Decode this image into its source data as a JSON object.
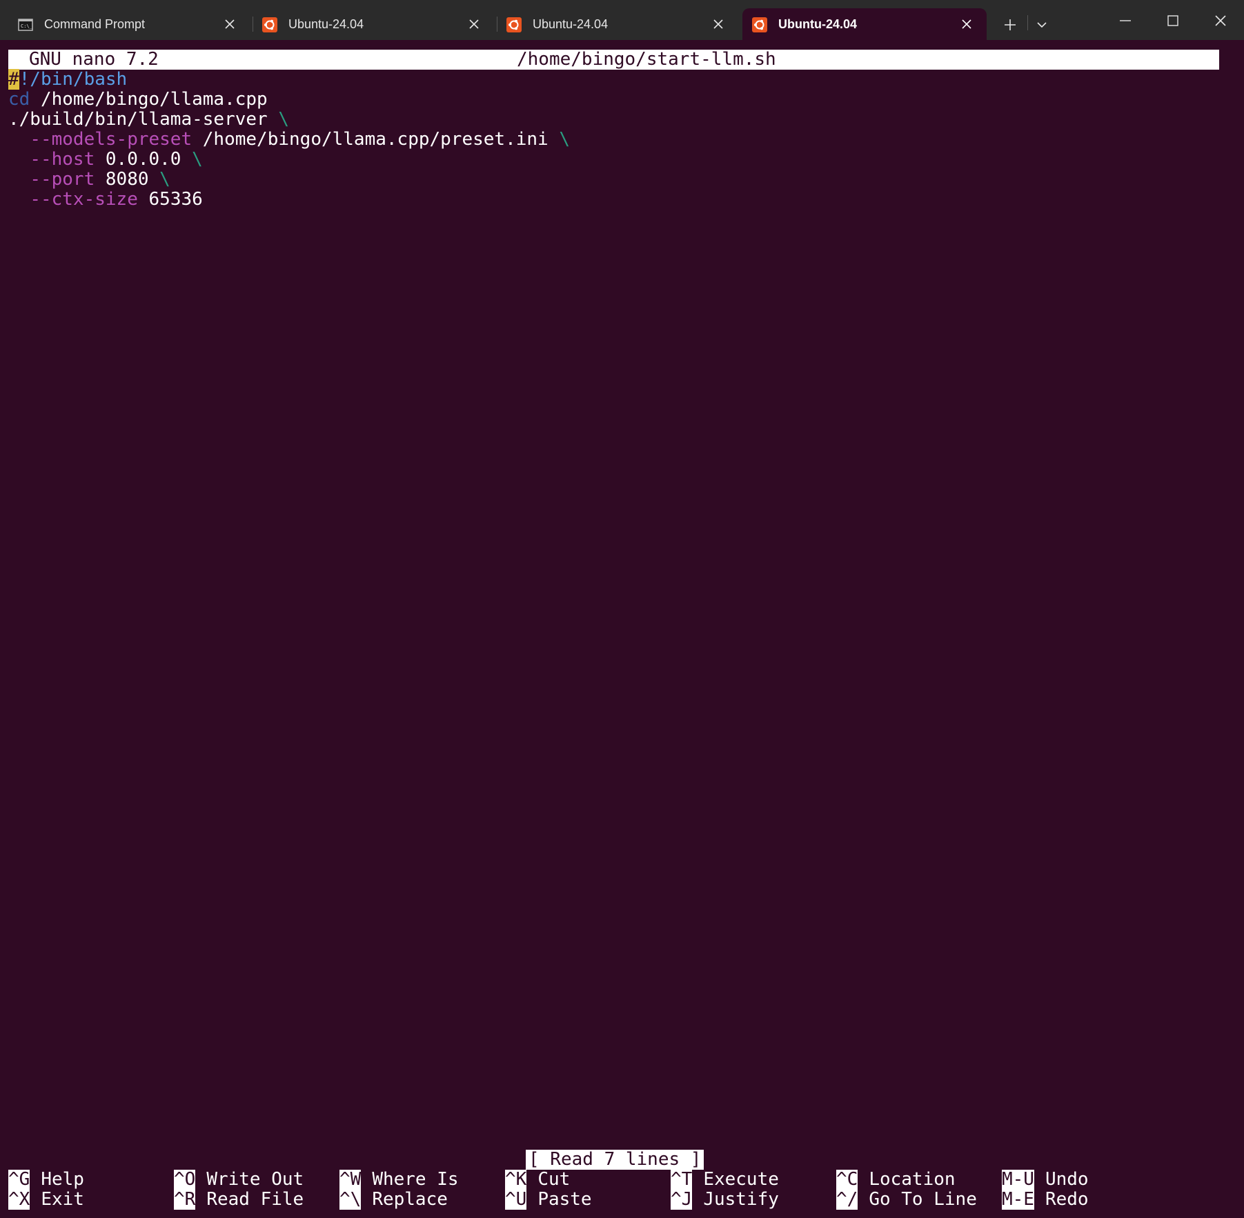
{
  "tabs": [
    {
      "label": "Command Prompt",
      "icon": "command-prompt-icon",
      "active": false
    },
    {
      "label": "Ubuntu-24.04",
      "icon": "ubuntu-icon",
      "active": false
    },
    {
      "label": "Ubuntu-24.04",
      "icon": "ubuntu-icon",
      "active": false
    },
    {
      "label": "Ubuntu-24.04",
      "icon": "ubuntu-icon",
      "active": true
    }
  ],
  "window_controls": [
    "new-tab-icon",
    "dropdown-icon",
    "minimize-icon",
    "maximize-icon",
    "close-icon"
  ],
  "colors": {
    "terminal_bg": "#300a24",
    "tabbar_bg": "#2b2b2b",
    "flag": "#b84fb8",
    "backslash": "#2a9d80",
    "shebang": "#5aa0e6",
    "cd_keyword": "#3a5fa8",
    "ubuntu_orange": "#e95420"
  },
  "nano": {
    "version": "GNU nano 7.2",
    "filename": "/home/bingo/start-llm.sh",
    "status_message": "[ Read 7 lines ]",
    "lines": {
      "l1": {
        "cursor": "#",
        "rest": "!/bin/bash"
      },
      "l2": {
        "keyword": "cd",
        "arg": " /home/bingo/llama.cpp"
      },
      "l3": {
        "cmd": "./build/bin/llama-server",
        "cont": "\\"
      },
      "l4": {
        "flag": "--models-preset",
        "value": "/home/bingo/llama.cpp/preset.ini",
        "cont": "\\"
      },
      "l5": {
        "flag": "--host",
        "value": "0.0.0.0",
        "cont": "\\"
      },
      "l6": {
        "flag": "--port",
        "value": "8080",
        "cont": "\\"
      },
      "l7": {
        "flag": "--ctx-size",
        "value": "65336"
      }
    },
    "shortcuts": {
      "help": {
        "key": "^G",
        "label": "Help"
      },
      "exit": {
        "key": "^X",
        "label": "Exit"
      },
      "write_out": {
        "key": "^O",
        "label": "Write Out"
      },
      "read_file": {
        "key": "^R",
        "label": "Read File"
      },
      "where_is": {
        "key": "^W",
        "label": "Where Is"
      },
      "replace": {
        "key": "^\\",
        "label": "Replace"
      },
      "cut": {
        "key": "^K",
        "label": "Cut"
      },
      "paste": {
        "key": "^U",
        "label": "Paste"
      },
      "execute": {
        "key": "^T",
        "label": "Execute"
      },
      "justify": {
        "key": "^J",
        "label": "Justify"
      },
      "location": {
        "key": "^C",
        "label": "Location"
      },
      "go_to_line": {
        "key": "^/",
        "label": "Go To Line"
      },
      "undo": {
        "key": "M-U",
        "label": "Undo"
      },
      "redo": {
        "key": "M-E",
        "label": "Redo"
      }
    }
  }
}
